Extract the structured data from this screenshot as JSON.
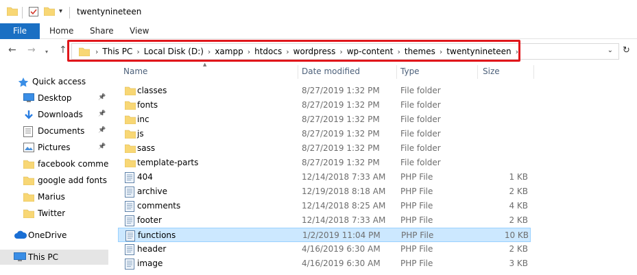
{
  "window": {
    "title": "twentynineteen"
  },
  "ribbon": {
    "tabs": [
      "File",
      "Home",
      "Share",
      "View"
    ]
  },
  "address": {
    "crumbs": [
      "This PC",
      "Local Disk (D:)",
      "xampp",
      "htdocs",
      "wordpress",
      "wp-content",
      "themes",
      "twentynineteen"
    ]
  },
  "icons": {
    "folder": "folder-icon",
    "php": "php-file-icon",
    "back": "back-arrow-icon",
    "forward": "forward-arrow-icon",
    "up": "up-arrow-icon",
    "refresh": "refresh-icon",
    "pin": "pin-icon",
    "star": "quick-access-star-icon",
    "cloud": "onedrive-cloud-icon",
    "pc": "this-pc-icon"
  },
  "colors": {
    "accent": "#1a6fc3",
    "highlight": "#e0161b",
    "selected_row": "#cce8ff",
    "folder": "#f8d775"
  },
  "nav": {
    "items": [
      {
        "label": "Quick access",
        "icon": "quick-access-star-icon",
        "pinned": false
      },
      {
        "label": "Desktop",
        "icon": "desktop-icon",
        "pinned": true
      },
      {
        "label": "Downloads",
        "icon": "downloads-icon",
        "pinned": true
      },
      {
        "label": "Documents",
        "icon": "documents-icon",
        "pinned": true
      },
      {
        "label": "Pictures",
        "icon": "pictures-icon",
        "pinned": true
      },
      {
        "label": "facebook comment",
        "icon": "folder-icon",
        "pinned": false
      },
      {
        "label": "google add fonts",
        "icon": "folder-icon",
        "pinned": false
      },
      {
        "label": "Marius",
        "icon": "folder-icon",
        "pinned": false
      },
      {
        "label": "Twitter",
        "icon": "folder-icon",
        "pinned": false
      },
      {
        "label": "OneDrive",
        "icon": "onedrive-cloud-icon",
        "pinned": false
      },
      {
        "label": "This PC",
        "icon": "this-pc-icon",
        "pinned": false,
        "selected": true
      }
    ]
  },
  "columns": [
    "Name",
    "Date modified",
    "Type",
    "Size"
  ],
  "files": [
    {
      "name": "classes",
      "date": "8/27/2019 1:32 PM",
      "type": "File folder",
      "size": "",
      "kind": "folder"
    },
    {
      "name": "fonts",
      "date": "8/27/2019 1:32 PM",
      "type": "File folder",
      "size": "",
      "kind": "folder"
    },
    {
      "name": "inc",
      "date": "8/27/2019 1:32 PM",
      "type": "File folder",
      "size": "",
      "kind": "folder"
    },
    {
      "name": "js",
      "date": "8/27/2019 1:32 PM",
      "type": "File folder",
      "size": "",
      "kind": "folder"
    },
    {
      "name": "sass",
      "date": "8/27/2019 1:32 PM",
      "type": "File folder",
      "size": "",
      "kind": "folder"
    },
    {
      "name": "template-parts",
      "date": "8/27/2019 1:32 PM",
      "type": "File folder",
      "size": "",
      "kind": "folder"
    },
    {
      "name": "404",
      "date": "12/14/2018 7:33 AM",
      "type": "PHP File",
      "size": "1 KB",
      "kind": "php"
    },
    {
      "name": "archive",
      "date": "12/19/2018 8:18 AM",
      "type": "PHP File",
      "size": "2 KB",
      "kind": "php"
    },
    {
      "name": "comments",
      "date": "12/14/2018 8:25 AM",
      "type": "PHP File",
      "size": "4 KB",
      "kind": "php"
    },
    {
      "name": "footer",
      "date": "12/14/2018 7:33 AM",
      "type": "PHP File",
      "size": "2 KB",
      "kind": "php"
    },
    {
      "name": "functions",
      "date": "1/2/2019 11:04 PM",
      "type": "PHP File",
      "size": "10 KB",
      "kind": "php",
      "selected": true
    },
    {
      "name": "header",
      "date": "4/16/2019 6:30 AM",
      "type": "PHP File",
      "size": "2 KB",
      "kind": "php"
    },
    {
      "name": "image",
      "date": "4/16/2019 6:30 AM",
      "type": "PHP File",
      "size": "3 KB",
      "kind": "php"
    }
  ]
}
